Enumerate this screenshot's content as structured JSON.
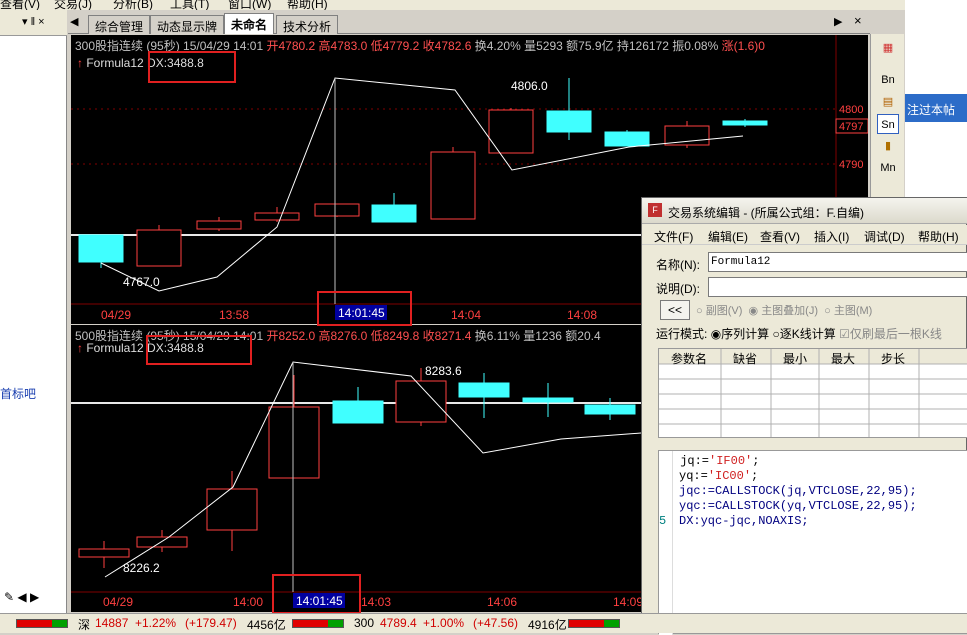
{
  "menubar": [
    "查看(V)",
    "交易(J)",
    "分析(B)",
    "工具(T)",
    "窗口(W)",
    "帮助(H)"
  ],
  "left_panel": {
    "link_text": "首标吧",
    "controls": "▾ ‖ ×"
  },
  "tabs": [
    "综合管理",
    "动态显示牌",
    "未命名",
    "技术分析"
  ],
  "tab_controls": {
    "prev": "◀",
    "next": "▶",
    "close": "×"
  },
  "panel1": {
    "name": "300股指连续 (95秒)",
    "date": "15/04/29",
    "time": "14:01",
    "open": "开4780.2",
    "high": "高4783.0",
    "low": "低4779.2",
    "close": "收4782.6",
    "turnover_rate": "换4.20%",
    "volume": "量5293",
    "amount": "额75.9亿",
    "position": "持126172",
    "amplitude": "振0.08%",
    "rise": "涨(1.6)0",
    "formula": "Formula12",
    "dx": "DX:3488.8",
    "price_labels": [
      "4800",
      "4797",
      "4790"
    ],
    "annot_high": "4806.0",
    "annot_low": "4767.0",
    "x_ticks": [
      "04/29",
      "13:58",
      "14:04",
      "14:08"
    ],
    "cursor_time": "14:01:45"
  },
  "panel2": {
    "name": "500股指连续 (95秒)",
    "date": "15/04/29",
    "time": "14:01",
    "open": "开8252.0",
    "high": "高8276.0",
    "low": "低8249.8",
    "close": "收8271.4",
    "turnover_rate": "换6.11%",
    "volume": "量1236",
    "amount": "额20.4",
    "formula": "Formula12",
    "dx": "DX:3488.8",
    "annot_high": "8283.6",
    "annot_low": "8226.2",
    "x_ticks": [
      "04/29",
      "14:00",
      "14:03",
      "14:06",
      "14:09"
    ],
    "cursor_time": "14:01:45"
  },
  "right_toolbar": [
    "Bn",
    "Sn",
    "Mn"
  ],
  "right_panel_text": "注过本帖",
  "dialog": {
    "title": "交易系统编辑 - (所属公式组：F.自编)",
    "menus": [
      "文件(F)",
      "编辑(E)",
      "查看(V)",
      "插入(I)",
      "调试(D)",
      "帮助(H)"
    ],
    "name_label": "名称(N):",
    "name_value": "Formula12",
    "desc_label": "说明(D):",
    "collapse_btn": "<<",
    "radio_fig": "副图(V)",
    "radio_main_overlay": "主图叠加(J)",
    "radio_main": "主图(M)",
    "mode_label": "运行模式:",
    "mode_seq": "序列计算",
    "mode_bar": "逐K线计算",
    "refresh_last": "仅刷最后一根K线",
    "param_headers": [
      "参数名",
      "缺省",
      "最小",
      "最大",
      "步长"
    ],
    "code": [
      {
        "num": "",
        "pre": " jq:=",
        "str": "'IF00'",
        "post": ";"
      },
      {
        "num": "",
        "pre": "yq:=",
        "str": "'IC00'",
        "post": ";"
      },
      {
        "num": "",
        "pre": "jqc:=CALLSTOCK(jq,VTCLOSE,22,95);",
        "str": "",
        "post": ""
      },
      {
        "num": "",
        "pre": "yqc:=CALLSTOCK(yq,VTCLOSE,22,95);",
        "str": "",
        "post": ""
      },
      {
        "num": "5",
        "pre": "DX:yqc-jqc,NOAXIS;",
        "str": "",
        "post": ""
      }
    ]
  },
  "statusbar": {
    "sz_label": "深",
    "sz_index": "14887",
    "sz_change": "+1.22%",
    "sz_points": "(+179.47)",
    "sz_amount": "4456亿",
    "hs_label": "300",
    "hs_index": "4789.4",
    "hs_change": "+1.00%",
    "hs_points": "(+47.56)",
    "hs_amount": "4916亿"
  },
  "colors": {
    "up": "#ff4040",
    "down": "#40ffff",
    "line": "#ffffff",
    "grid": "#800000"
  }
}
